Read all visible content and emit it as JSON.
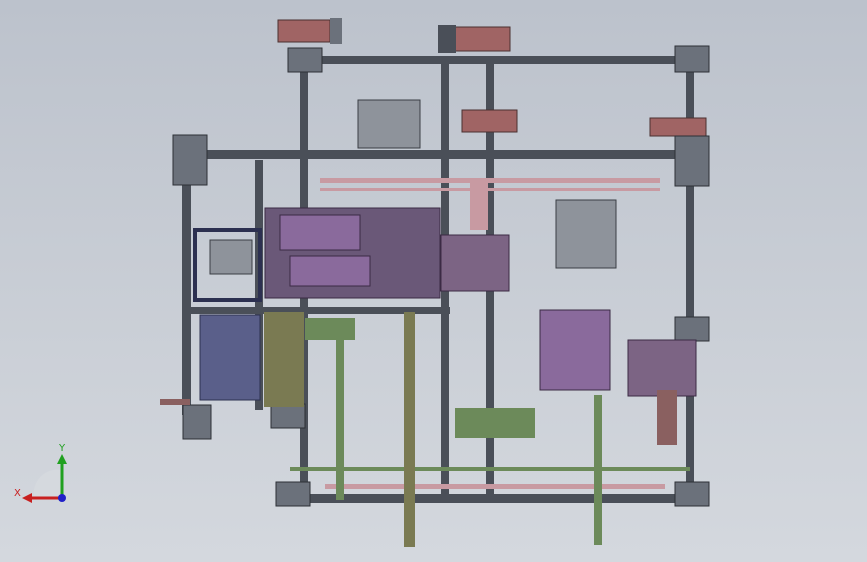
{
  "viewport": {
    "background_top": "#bcc2cc",
    "background_bottom": "#d4d8de"
  },
  "colors": {
    "frame_dark": "#4a4f58",
    "frame_mid": "#6b717b",
    "plate_gray": "#8e939b",
    "motor_red": "#a06464",
    "rail_pink": "#c89aa2",
    "purple_block": "#8a6a9c",
    "purple_plate": "#7c6484",
    "green_rod": "#6c8a5a",
    "blue_frame": "#5a5f8a",
    "olive": "#7a7a52"
  },
  "triad": {
    "x_label": "X",
    "y_label": "Y",
    "x_color": "#c82020",
    "y_color": "#20a020",
    "z_color": "#2020c8"
  }
}
